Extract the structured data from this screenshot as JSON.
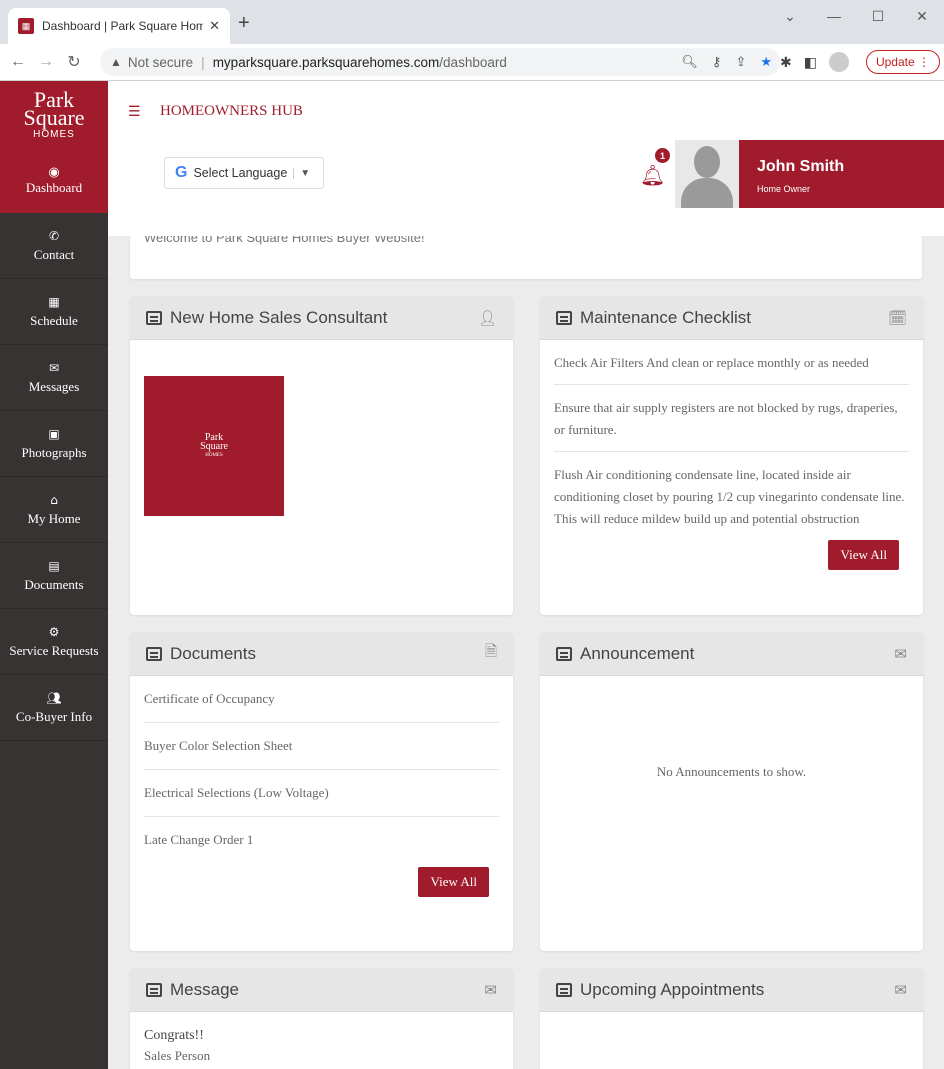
{
  "browser": {
    "tab_title": "Dashboard | Park Square Homes",
    "tab_close": "✕",
    "new_tab": "+",
    "url_warning": "Not secure",
    "url_host": "myparksquare.parksquarehomes.com",
    "url_path": "/dashboard",
    "update_label": "Update"
  },
  "sidebar": {
    "logo_brand_1": "Park",
    "logo_brand_2": "Square",
    "logo_sub": "HOMES",
    "items": [
      {
        "label": "Dashboard",
        "icon": "dashboard-icon"
      },
      {
        "label": "Contact",
        "icon": "phone-icon"
      },
      {
        "label": "Schedule",
        "icon": "calendar-icon"
      },
      {
        "label": "Messages",
        "icon": "envelope-icon"
      },
      {
        "label": "Photographs",
        "icon": "image-icon"
      },
      {
        "label": "My Home",
        "icon": "home-icon"
      },
      {
        "label": "Documents",
        "icon": "document-icon"
      },
      {
        "label": "Service Requests",
        "icon": "gears-icon"
      },
      {
        "label": "Co-Buyer Info",
        "icon": "users-icon"
      }
    ]
  },
  "header": {
    "hub_title": "HOMEOWNERS HUB",
    "language_label": "Select Language",
    "notification_count": "1",
    "user_name": "John Smith",
    "user_role": "Home Owner"
  },
  "welcome_text": "Welcome to Park Square Homes Buyer Website!",
  "consultant": {
    "title": "New Home Sales Consultant",
    "logo_text_1": "Park",
    "logo_text_2": "Square",
    "logo_text_3": "HOMES"
  },
  "maintenance": {
    "title": "Maintenance Checklist",
    "items": [
      "Check Air Filters And clean or replace monthly or as needed",
      "Ensure that air supply registers are not blocked by rugs, draperies, or furniture.",
      "Flush Air conditioning condensate line, located inside air conditioning closet by pouring 1/2 cup vinegarinto condensate line. This will reduce mildew build up and potential obstruction"
    ],
    "view_all": "View All"
  },
  "documents": {
    "title": "Documents",
    "items": [
      "Certificate of Occupancy",
      "Buyer Color Selection Sheet",
      "Electrical Selections (Low Voltage)",
      "Late Change Order 1"
    ],
    "view_all": "View All"
  },
  "announcement": {
    "title": "Announcement",
    "empty_text": "No Announcements to show."
  },
  "message": {
    "title": "Message",
    "heading": "Congrats!!",
    "from": "Sales Person"
  },
  "appointments": {
    "title": "Upcoming Appointments"
  },
  "colors": {
    "brand": "#a01c2c",
    "sidebar": "#363332"
  }
}
